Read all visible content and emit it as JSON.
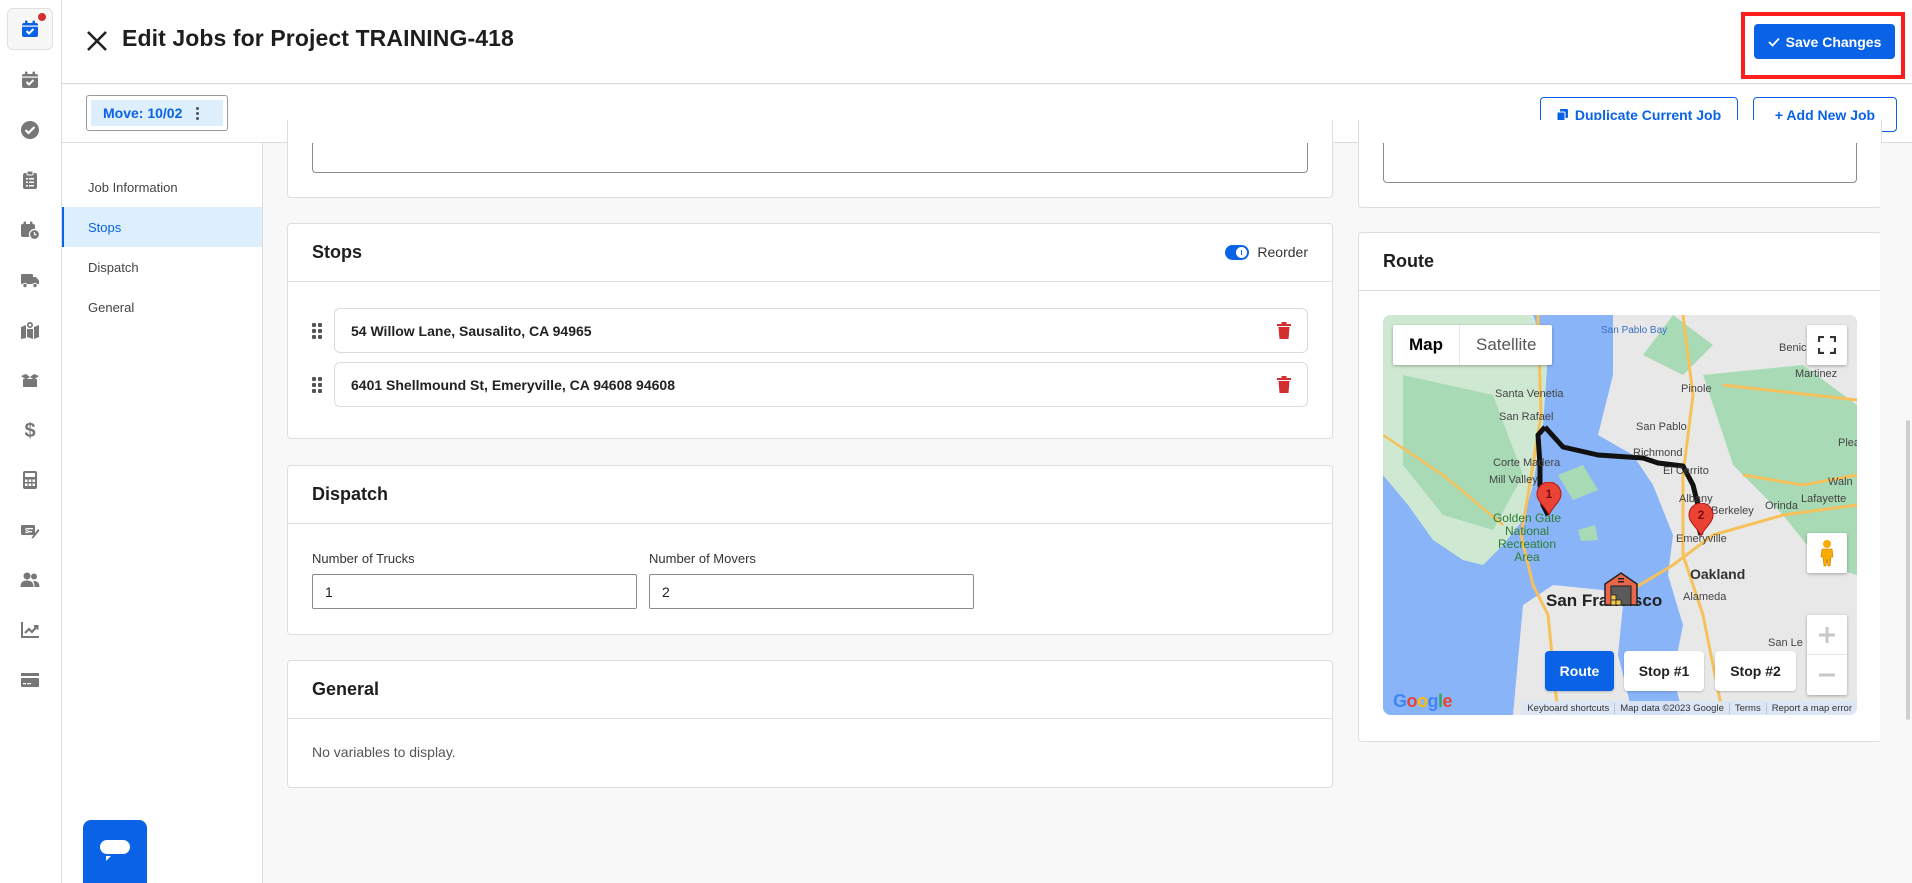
{
  "header": {
    "title": "Edit Jobs for Project TRAINING-418",
    "save_label": "Save Changes"
  },
  "toolbar": {
    "job_tab_label": "Move: 10/02",
    "duplicate_label": "Duplicate Current Job",
    "add_label": "+ Add New Job"
  },
  "rail": {
    "items": [
      {
        "icon": "calendar-check-icon",
        "active": true,
        "has_notification": true
      },
      {
        "icon": "calendar-check-icon"
      },
      {
        "icon": "check-circle-icon"
      },
      {
        "icon": "clipboard-list-icon"
      },
      {
        "icon": "calendar-clock-icon"
      },
      {
        "icon": "truck-icon"
      },
      {
        "icon": "map-pin-icon"
      },
      {
        "icon": "box-open-icon"
      },
      {
        "icon": "dollar-icon"
      },
      {
        "icon": "calculator-icon"
      },
      {
        "icon": "money-check-edit-icon"
      },
      {
        "icon": "users-icon"
      },
      {
        "icon": "chart-line-icon"
      },
      {
        "icon": "credit-card-icon"
      }
    ]
  },
  "section_nav": {
    "items": [
      {
        "label": "Job Information",
        "active": false
      },
      {
        "label": "Stops",
        "active": true
      },
      {
        "label": "Dispatch",
        "active": false
      },
      {
        "label": "General",
        "active": false
      }
    ]
  },
  "stops": {
    "title": "Stops",
    "reorder_label": "Reorder",
    "reorder_on": true,
    "items": [
      {
        "address": "54 Willow Lane, Sausalito, CA 94965"
      },
      {
        "address": "6401 Shellmound St, Emeryville, CA 94608 94608"
      }
    ]
  },
  "dispatch": {
    "title": "Dispatch",
    "trucks_label": "Number of Trucks",
    "trucks_value": "1",
    "movers_label": "Number of Movers",
    "movers_value": "2"
  },
  "general": {
    "title": "General",
    "empty_text": "No variables to display."
  },
  "route": {
    "title": "Route",
    "map_type_options": [
      "Map",
      "Satellite"
    ],
    "map_type_selected": "Map",
    "buttons": {
      "route": "Route",
      "stop1": "Stop #1",
      "stop2": "Stop #2"
    },
    "markers": [
      "1",
      "2"
    ],
    "labels": {
      "san_pablo_bay": "San Pablo Bay",
      "benicia": "Benic",
      "martinez": "Martinez",
      "santa_venetia": "Santa Venetia",
      "san_rafael": "San Rafael",
      "pinole": "Pinole",
      "san_pablo": "San Pablo",
      "richmond": "Richmond",
      "corte_madera": "Corte Madera",
      "el_cerrito": "El Cerrito",
      "mill_valley": "Mill Valley",
      "albany": "Albany",
      "berkeley": "Berkeley",
      "orinda": "Orinda",
      "lafayette": "Lafayette",
      "walnut": "Waln",
      "pleasant": "Plea",
      "ggnra": "Golden Gate National Recreation Area",
      "emeryville": "Emeryville",
      "oakland": "Oakland",
      "alameda": "Alameda",
      "san_francisco": "San Francisco",
      "san_leandro": "San Le"
    },
    "google_logo": "Google",
    "attribution": [
      "Keyboard shortcuts",
      "Map data ©2023 Google",
      "Terms",
      "Report a map error"
    ]
  }
}
